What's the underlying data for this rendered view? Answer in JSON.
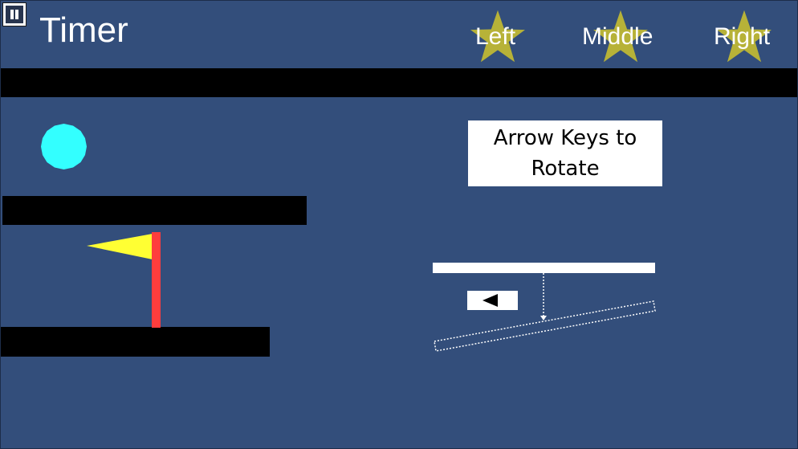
{
  "hud": {
    "timer_label": "Timer",
    "stars": [
      {
        "label": "Left"
      },
      {
        "label": "Middle"
      },
      {
        "label": "Right"
      }
    ]
  },
  "hint": {
    "line1": "Arrow Keys to",
    "line2": "Rotate"
  },
  "colors": {
    "background": "#334e7b",
    "platform": "#000000",
    "ball": "#33ffff",
    "flag": "#ffff33",
    "flagpole": "#ff3d3d",
    "star": "#b7b238"
  },
  "icons": {
    "pause": "pause-icon",
    "star": "star-icon",
    "left_arrow": "left-arrow-icon"
  }
}
